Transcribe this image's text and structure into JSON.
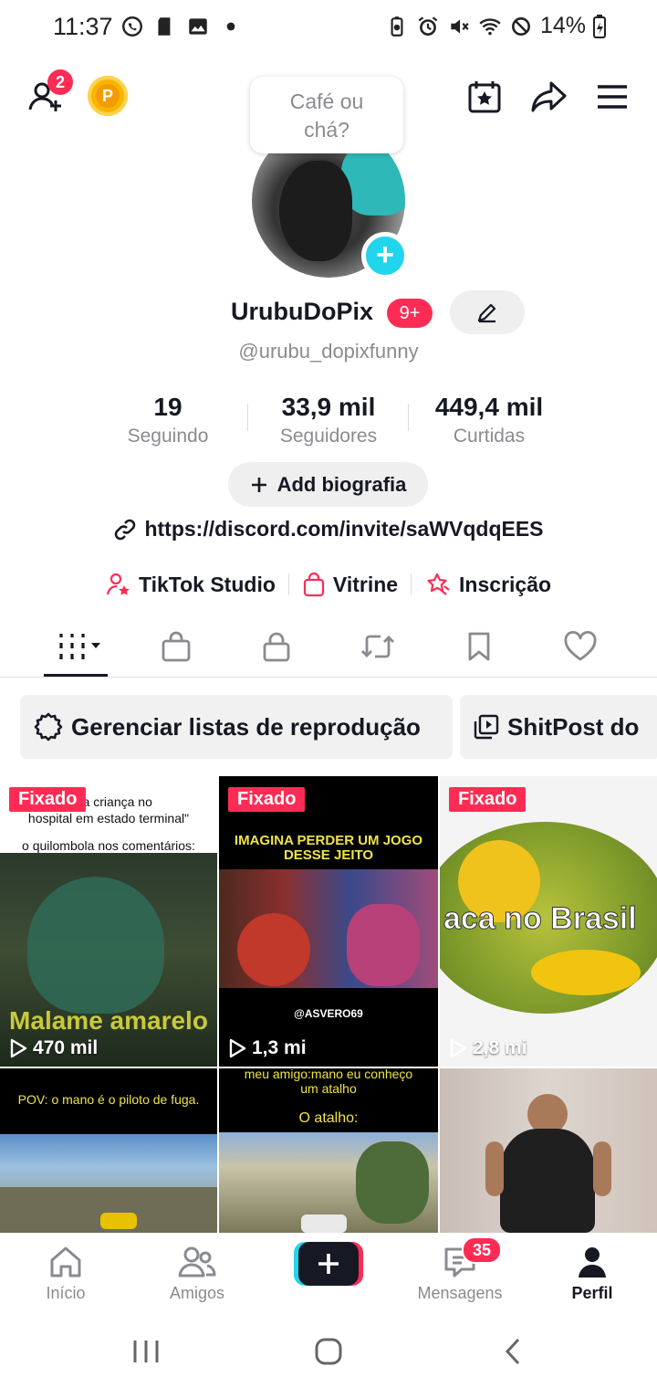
{
  "status_bar": {
    "time": "11:37",
    "battery": "14%"
  },
  "header": {
    "friend_requests_count": "2",
    "coin_label": "P",
    "bubble_text_1": "Café ou",
    "bubble_text_2": "chá?"
  },
  "profile": {
    "username": "UrubuDoPix",
    "level_badge": "9+",
    "handle": "@urubu_dopixfunny",
    "stats": [
      {
        "value": "19",
        "label": "Seguindo"
      },
      {
        "value": "33,9 mil",
        "label": "Seguidores"
      },
      {
        "value": "449,4 mil",
        "label": "Curtidas"
      }
    ],
    "add_bio_label": "Add biografia",
    "link": "https://discord.com/invite/saWVqdqEES",
    "tools": [
      {
        "label": "TikTok Studio",
        "icon": "person-star-icon"
      },
      {
        "label": "Vitrine",
        "icon": "shopping-bag-icon"
      },
      {
        "label": "Inscrição",
        "icon": "subscription-star-icon"
      }
    ]
  },
  "tabs": [
    "videos-grid-icon",
    "shop-bag-icon",
    "lock-icon",
    "repost-icon",
    "bookmark-icon",
    "heart-icon"
  ],
  "chips": [
    {
      "label": "Gerenciar listas de reprodução",
      "icon": "gear-icon"
    },
    {
      "label": "ShitPost do",
      "icon": "playlist-icon"
    }
  ],
  "videos": [
    {
      "pinned": "Fixado",
      "views": "470 mil",
      "caption_top_1": "uma criança no",
      "caption_top_2": "hospital em estado terminal\"",
      "caption_mid": "o quilombola nos comentários:",
      "caption_bottom": "Malame amarelo"
    },
    {
      "pinned": "Fixado",
      "views": "1,3 mi",
      "caption_top_1": "IMAGINA PERDER UM JOGO",
      "caption_top_2": "DESSE JEITO",
      "caption_bottom": "@ASVERO69"
    },
    {
      "pinned": "Fixado",
      "views": "2,8 mi",
      "caption_mid": "aca no Brasil"
    },
    {
      "caption_top_1": "POV: o mano é o piloto de fuga."
    },
    {
      "caption_top_1": "meu amigo:mano eu conheço",
      "caption_top_2": "um atalho",
      "caption_mid": "O atalho:"
    },
    {}
  ],
  "bottom_nav": {
    "home": "Início",
    "friends": "Amigos",
    "messages": "Mensagens",
    "messages_badge": "35",
    "profile": "Perfil"
  },
  "colors": {
    "accent": "#fe2c55",
    "cyan": "#20d5ec",
    "text": "#161823",
    "muted": "#8a8b91"
  }
}
